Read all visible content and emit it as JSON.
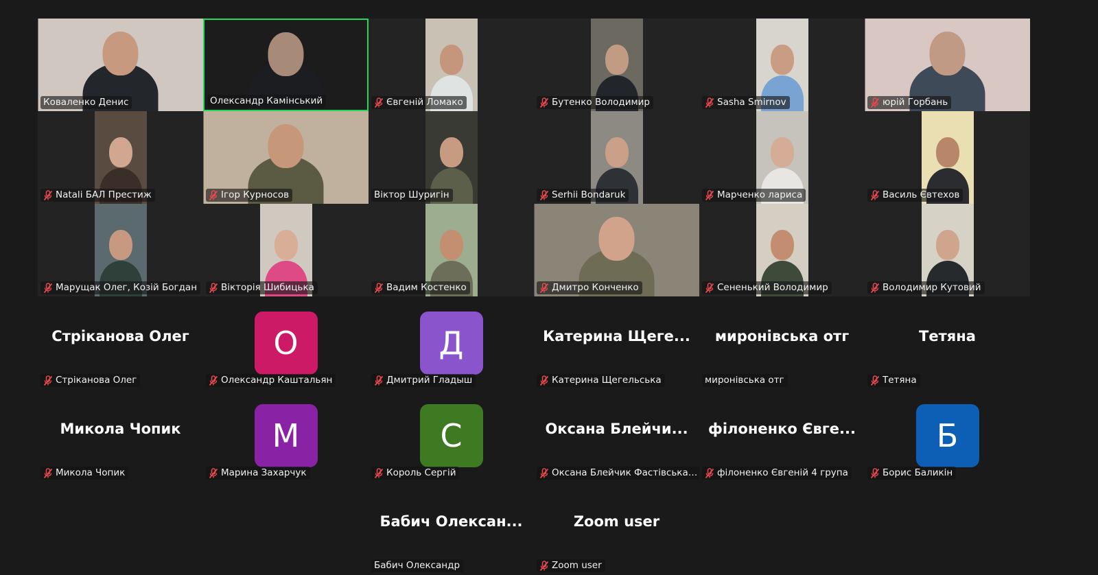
{
  "participants": [
    {
      "name": "Коваленко Денис",
      "muted": false,
      "type": "video",
      "bg": "#cfc7c0",
      "shirt": "#23262b",
      "skin": "#c79a80",
      "wide": true
    },
    {
      "name": "Олександр Камінський",
      "muted": false,
      "type": "video",
      "active": true,
      "bg": "#1c1c1c",
      "shirt": "#1b1d20",
      "skin": "#a88a78",
      "wide": true
    },
    {
      "name": "Євгеній Ломако",
      "muted": true,
      "type": "video",
      "bg": "#c9c2b4",
      "shirt": "#dfe3e2",
      "skin": "#c6967c"
    },
    {
      "name": "Бутенко Володимир",
      "muted": true,
      "type": "video",
      "bg": "#6c6960",
      "shirt": "#22262a",
      "skin": "#c29b83"
    },
    {
      "name": "Sasha Smirnov",
      "muted": true,
      "type": "video",
      "bg": "#d8d4ce",
      "shirt": "#79a3d2",
      "skin": "#c99c84"
    },
    {
      "name": "юрій Горбань",
      "muted": true,
      "type": "video",
      "bg": "#d8c7c2",
      "shirt": "#3f4a58",
      "skin": "#c19a85",
      "wide": true
    },
    {
      "name": "Natali БАЛ Престиж",
      "muted": true,
      "type": "video",
      "bg": "#5a4b41",
      "shirt": "#3b2d28",
      "skin": "#d2a790"
    },
    {
      "name": "Ігор Курносов",
      "muted": true,
      "type": "video",
      "bg": "#bfb19e",
      "shirt": "#5b5b43",
      "skin": "#c69779",
      "wide": true
    },
    {
      "name": "Віктор Шуригін",
      "muted": false,
      "type": "video",
      "bg": "#3a3a34",
      "shirt": "#5c5f49",
      "skin": "#c69b82"
    },
    {
      "name": "Serhii Bondaruk",
      "muted": true,
      "type": "video",
      "bg": "#8d8a83",
      "shirt": "#2e3135",
      "skin": "#caa088"
    },
    {
      "name": "Марченко лариса",
      "muted": true,
      "type": "video",
      "bg": "#c6c2bc",
      "shirt": "#e8e6e3",
      "skin": "#d5ac95"
    },
    {
      "name": "Василь Євтехов",
      "muted": true,
      "type": "video",
      "bg": "#e9dfb2",
      "shirt": "#2a2c30",
      "skin": "#b88668"
    },
    {
      "name": "Марущак Олег, Козій Богдан",
      "muted": true,
      "type": "video",
      "bg": "#5a6a6e",
      "shirt": "#2f3f3a",
      "skin": "#c79980"
    },
    {
      "name": "Вікторія Шибицька",
      "muted": true,
      "type": "video",
      "bg": "#d0c9c0",
      "shirt": "#de4a84",
      "skin": "#d9ae96"
    },
    {
      "name": "Вадим Костенко",
      "muted": true,
      "type": "video",
      "bg": "#9cae8f",
      "shirt": "#6c6e5a",
      "skin": "#c48f70"
    },
    {
      "name": "Дмитро Конченко",
      "muted": true,
      "type": "video",
      "bg": "#8a8577",
      "shirt": "#6f6c56",
      "skin": "#d0a38a",
      "wide": true
    },
    {
      "name": "Сененький Володимир",
      "muted": true,
      "type": "video",
      "bg": "#d4cfc2",
      "shirt": "#3e4a3a",
      "skin": "#c38d72"
    },
    {
      "name": "Володимир Кутовий",
      "muted": true,
      "type": "video",
      "bg": "#d6d2c6",
      "shirt": "#272a2d",
      "skin": "#d0a58e"
    },
    {
      "name": "Стріканова Олег",
      "muted": true,
      "type": "name",
      "display": "Стріканова Олег"
    },
    {
      "name": "Олександр Каштальян",
      "muted": true,
      "type": "avatar",
      "letter": "О",
      "color": "#cd1a66"
    },
    {
      "name": "Дмитрий Гладыш",
      "muted": true,
      "type": "avatar",
      "letter": "Д",
      "color": "#8a55cc"
    },
    {
      "name": "Катерина Щегельська",
      "muted": true,
      "type": "name",
      "display": "Катерина  Щеге..."
    },
    {
      "name": "миронівська отг",
      "muted": false,
      "type": "name",
      "display": "миронівська отг"
    },
    {
      "name": "Тетяна",
      "muted": true,
      "type": "name",
      "display": "Тетяна"
    },
    {
      "name": "Микола Чопик",
      "muted": true,
      "type": "name",
      "display": "Микола Чопик"
    },
    {
      "name": "Марина Захарчук",
      "muted": true,
      "type": "avatar",
      "letter": "М",
      "color": "#8a22a6"
    },
    {
      "name": "Король Сергій",
      "muted": true,
      "type": "avatar",
      "letter": "С",
      "color": "#3d7a22"
    },
    {
      "name": "Оксана Блейчик Фастівська гі...",
      "muted": true,
      "type": "name",
      "display": "Оксана  Блейчи..."
    },
    {
      "name": "філоненко Євгеній 4 група",
      "muted": true,
      "type": "name",
      "display": "філоненко  Євге..."
    },
    {
      "name": "Борис Баликін",
      "muted": true,
      "type": "avatar",
      "letter": "Б",
      "color": "#0d5fb5"
    },
    {
      "name": "Бабич Олександр",
      "muted": false,
      "type": "name",
      "display": "Бабич  Олексан..."
    },
    {
      "name": "Zoom user",
      "muted": true,
      "type": "name",
      "display": "Zoom user"
    }
  ]
}
